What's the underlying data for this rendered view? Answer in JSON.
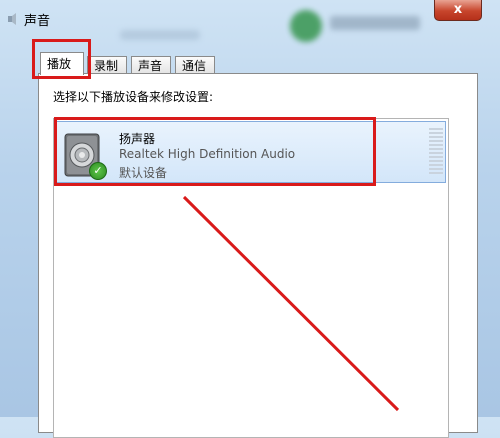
{
  "window": {
    "title": "声音",
    "close_glyph": "x"
  },
  "tabs": [
    {
      "label": "播放",
      "active": true
    },
    {
      "label": "录制",
      "active": false
    },
    {
      "label": "声音",
      "active": false
    },
    {
      "label": "通信",
      "active": false
    }
  ],
  "panel": {
    "instruction": "选择以下播放设备来修改设置:"
  },
  "devices": [
    {
      "name": "扬声器",
      "description": "Realtek High Definition Audio",
      "status": "默认设备",
      "icon": "speaker-icon",
      "default_badge": "check-icon",
      "selected": true
    }
  ],
  "colors": {
    "annotation": "#d91a1a",
    "selected_row": "#d3e6f9",
    "close_button": "#c7452c"
  }
}
